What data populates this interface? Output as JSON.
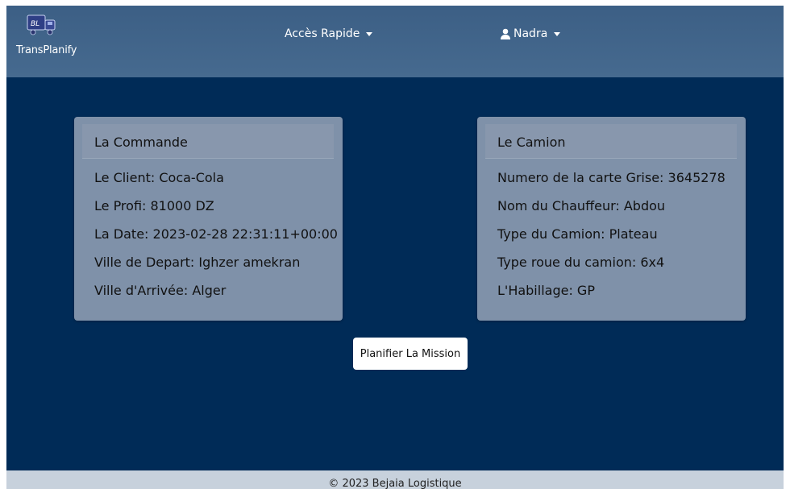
{
  "brand": {
    "logo_text": "BL",
    "name": "TransPlanify"
  },
  "nav": {
    "quick_access": "Accès Rapide",
    "user_name": "Nadra"
  },
  "commande": {
    "title": "La Commande",
    "client": "Le Client: Coca-Cola",
    "profit": "Le Profi: 81000 DZ",
    "date": "La Date: 2023-02-28 22:31:11+00:00",
    "depart": "Ville de Depart: Ighzer amekran",
    "arrivee": "Ville d'Arrivée: Alger"
  },
  "camion": {
    "title": "Le Camion",
    "carte_grise": "Numero de la carte Grise: 3645278",
    "chauffeur": "Nom du Chauffeur: Abdou",
    "type": "Type du Camion: Plateau",
    "roue": "Type roue du camion: 6x4",
    "habillage": "L'Habillage: GP"
  },
  "action": {
    "plan_button": "Planifier La Mission"
  },
  "footer": {
    "text": "© 2023 Bejaia Logistique"
  },
  "colors": {
    "page_background": "#002b57",
    "navbar": "#466a8f",
    "card": "#7f91a9",
    "footer": "#c7d1dc"
  }
}
